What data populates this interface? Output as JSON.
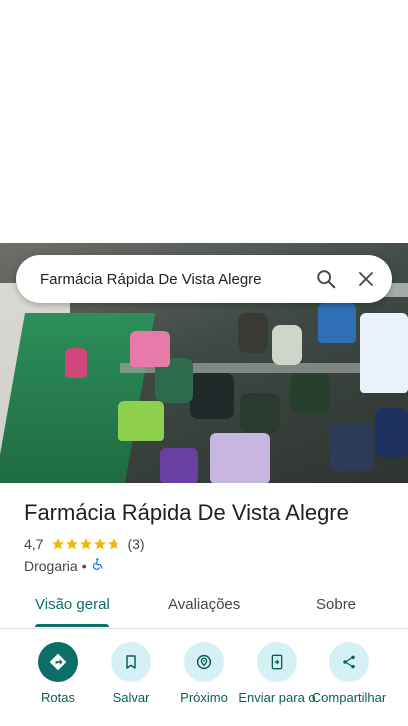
{
  "search": {
    "text": "Farmácia Rápida De Vista Alegre"
  },
  "place": {
    "title": "Farmácia Rápida De Vista Alegre",
    "rating": "4,7",
    "rating_value": 4.7,
    "review_count": "(3)",
    "category": "Drogaria",
    "separator": "•"
  },
  "tabs": [
    {
      "label": "Visão geral",
      "active": true
    },
    {
      "label": "Avaliações",
      "active": false
    },
    {
      "label": "Sobre",
      "active": false
    }
  ],
  "actions": [
    {
      "label": "Rotas",
      "icon": "directions-icon"
    },
    {
      "label": "Salvar",
      "icon": "bookmark-icon"
    },
    {
      "label": "Próximo",
      "icon": "nearby-icon"
    },
    {
      "label": "Enviar para o",
      "icon": "send-to-phone-icon"
    },
    {
      "label": "Compartilhar",
      "icon": "share-icon"
    }
  ],
  "colors": {
    "accent": "#0b6e68",
    "action_bg": "#d4f2f6",
    "star": "#f4b400",
    "accessibility": "#1a73e8"
  }
}
